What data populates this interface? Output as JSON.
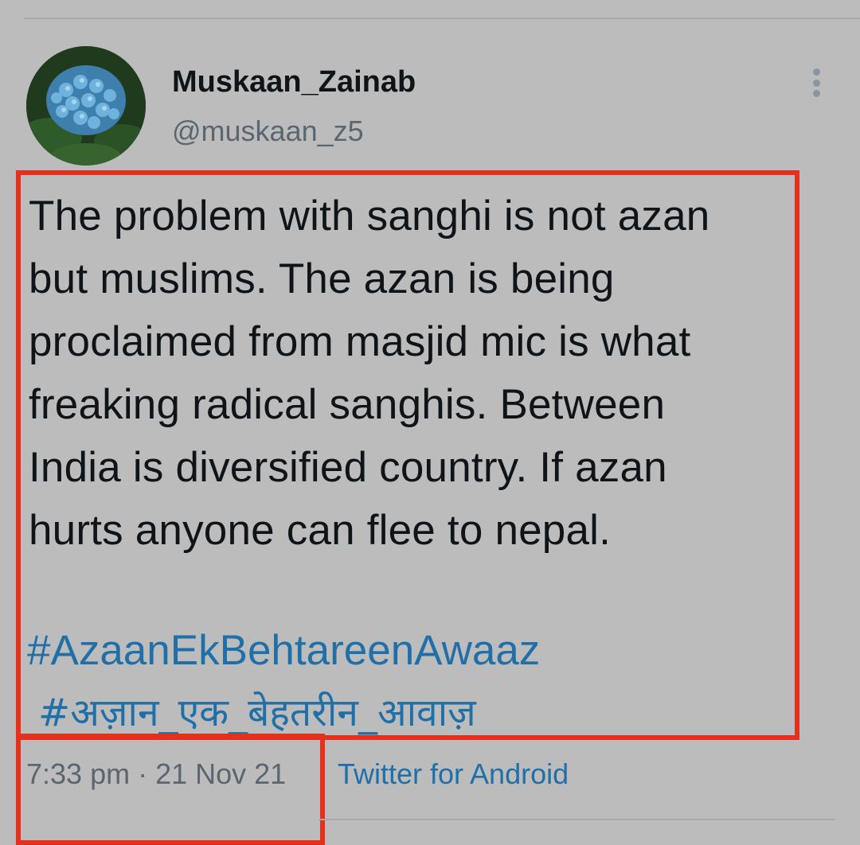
{
  "tweet": {
    "author": {
      "display_name": "Muskaan_Zainab",
      "handle": "@muskaan_z5"
    },
    "text": "The problem with sanghi is not azan\nbut muslims. The azan is being\nproclaimed from masjid mic is what\nfreaking radical sanghis. Between\nIndia is diversified country. If azan\nhurts anyone can flee to nepal.",
    "hashtags": [
      "#AzaanEkBehtareenAwaaz",
      "#अज़ान_एक_बेहतरीन_आवाज़"
    ],
    "timestamp": "7:33 pm · 21 Nov 21",
    "source": "Twitter for Android"
  },
  "icons": {
    "more": "vertical-ellipsis-icon"
  },
  "colors": {
    "background": "#bcbcbc",
    "link": "#1f6fa8",
    "highlight_box": "#e2311d",
    "secondary_text": "#5b6670"
  }
}
